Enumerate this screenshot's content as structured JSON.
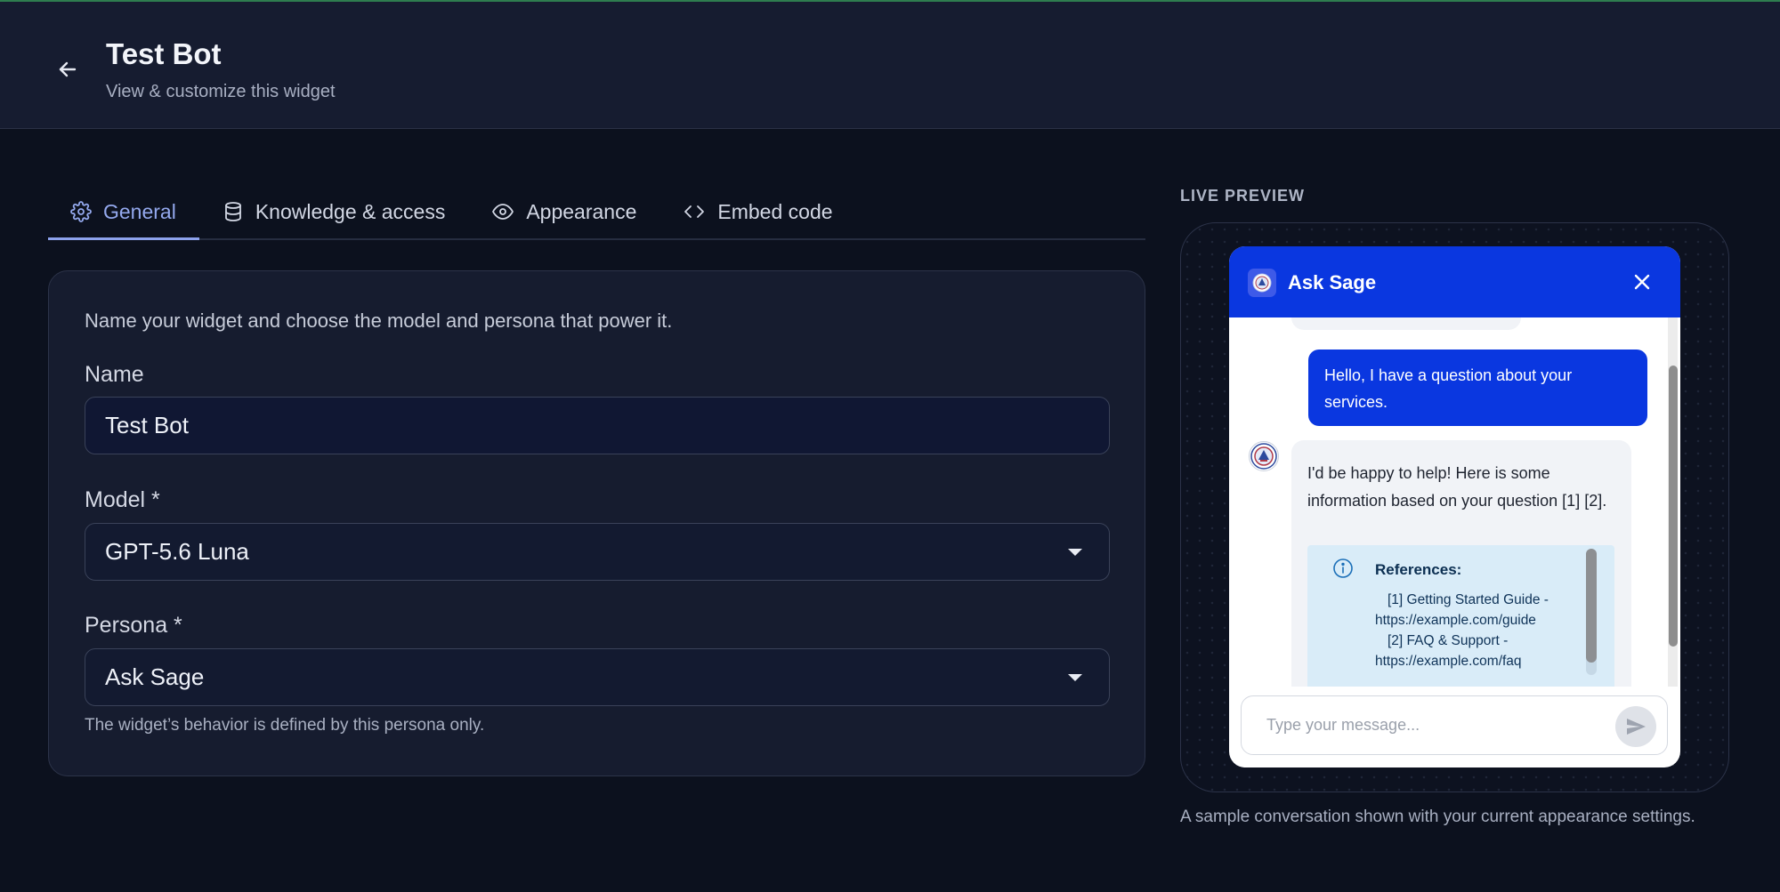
{
  "header": {
    "title": "Test Bot",
    "subtitle": "View & customize this widget",
    "back_icon": "arrow-left-icon"
  },
  "tabs": [
    {
      "label": "General",
      "icon": "gear-icon",
      "active": true
    },
    {
      "label": "Knowledge & access",
      "icon": "database-icon",
      "active": false
    },
    {
      "label": "Appearance",
      "icon": "eye-icon",
      "active": false
    },
    {
      "label": "Embed code",
      "icon": "code-icon",
      "active": false
    }
  ],
  "general": {
    "description": "Name your widget and choose the model and persona that power it.",
    "name_label": "Name",
    "name_value": "Test Bot",
    "model_label": "Model *",
    "model_value": "GPT-5.6 Luna",
    "persona_label": "Persona *",
    "persona_value": "Ask Sage",
    "persona_hint": "The widget’s behavior is defined by this persona only."
  },
  "preview": {
    "label": "LIVE PREVIEW",
    "caption": "A sample conversation shown with your current appearance settings.",
    "widget": {
      "title": "Ask Sage",
      "accent_color": "#0a37e0",
      "user_message": "Hello, I have a question about your services.",
      "bot_message": "I'd be happy to help! Here is some information based on your question [1] [2].",
      "references_title": "References:",
      "references": [
        "[1] Getting Started Guide -",
        "https://example.com/guide",
        "[2] FAQ & Support -",
        "https://example.com/faq"
      ],
      "input_placeholder": "Type your message..."
    }
  }
}
